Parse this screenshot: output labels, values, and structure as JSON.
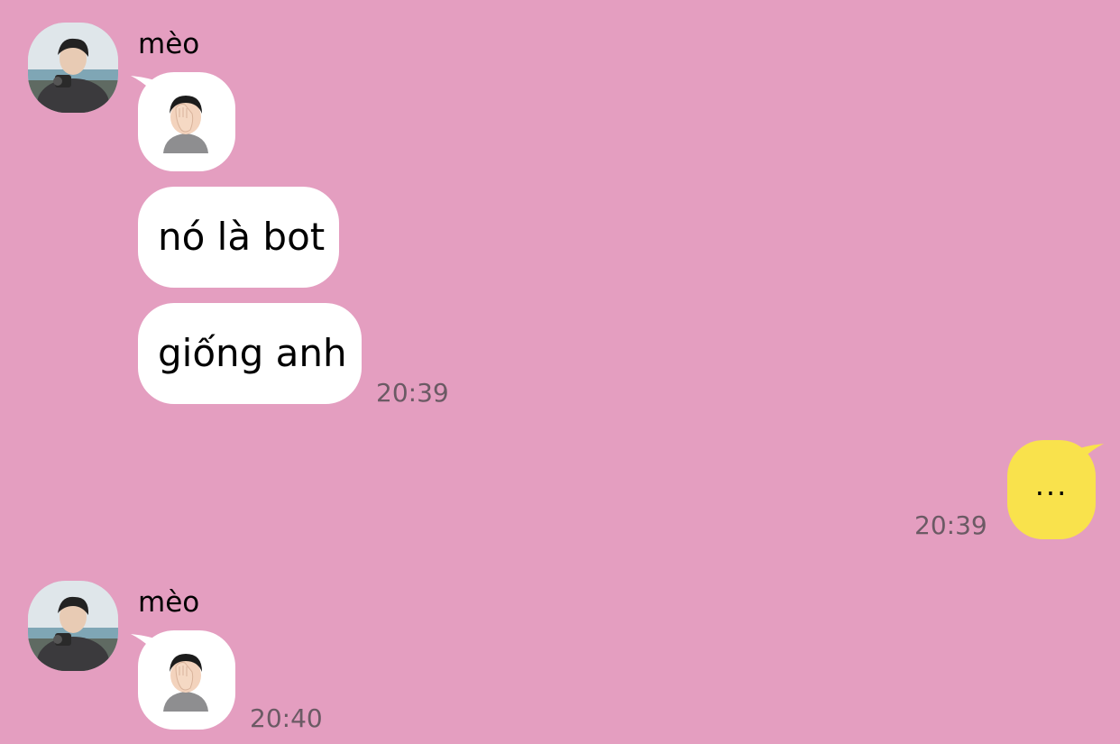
{
  "chat": {
    "groups": [
      {
        "sender": "mèo",
        "messages": [
          {
            "kind": "emoji",
            "emoji": "face-palm-emoji"
          },
          {
            "kind": "text",
            "text": "nó là bot"
          },
          {
            "kind": "text",
            "text": "giống anh",
            "time": "20:39"
          }
        ]
      },
      {
        "sender": "me",
        "messages": [
          {
            "kind": "text",
            "text": "...",
            "time": "20:39"
          }
        ]
      },
      {
        "sender": "mèo",
        "messages": [
          {
            "kind": "emoji",
            "emoji": "face-palm-emoji",
            "time": "20:40"
          }
        ]
      }
    ]
  },
  "colors": {
    "background": "#e49ec0",
    "incoming_bubble": "#ffffff",
    "outgoing_bubble": "#f9e24c",
    "timestamp": "#6b5a64"
  }
}
